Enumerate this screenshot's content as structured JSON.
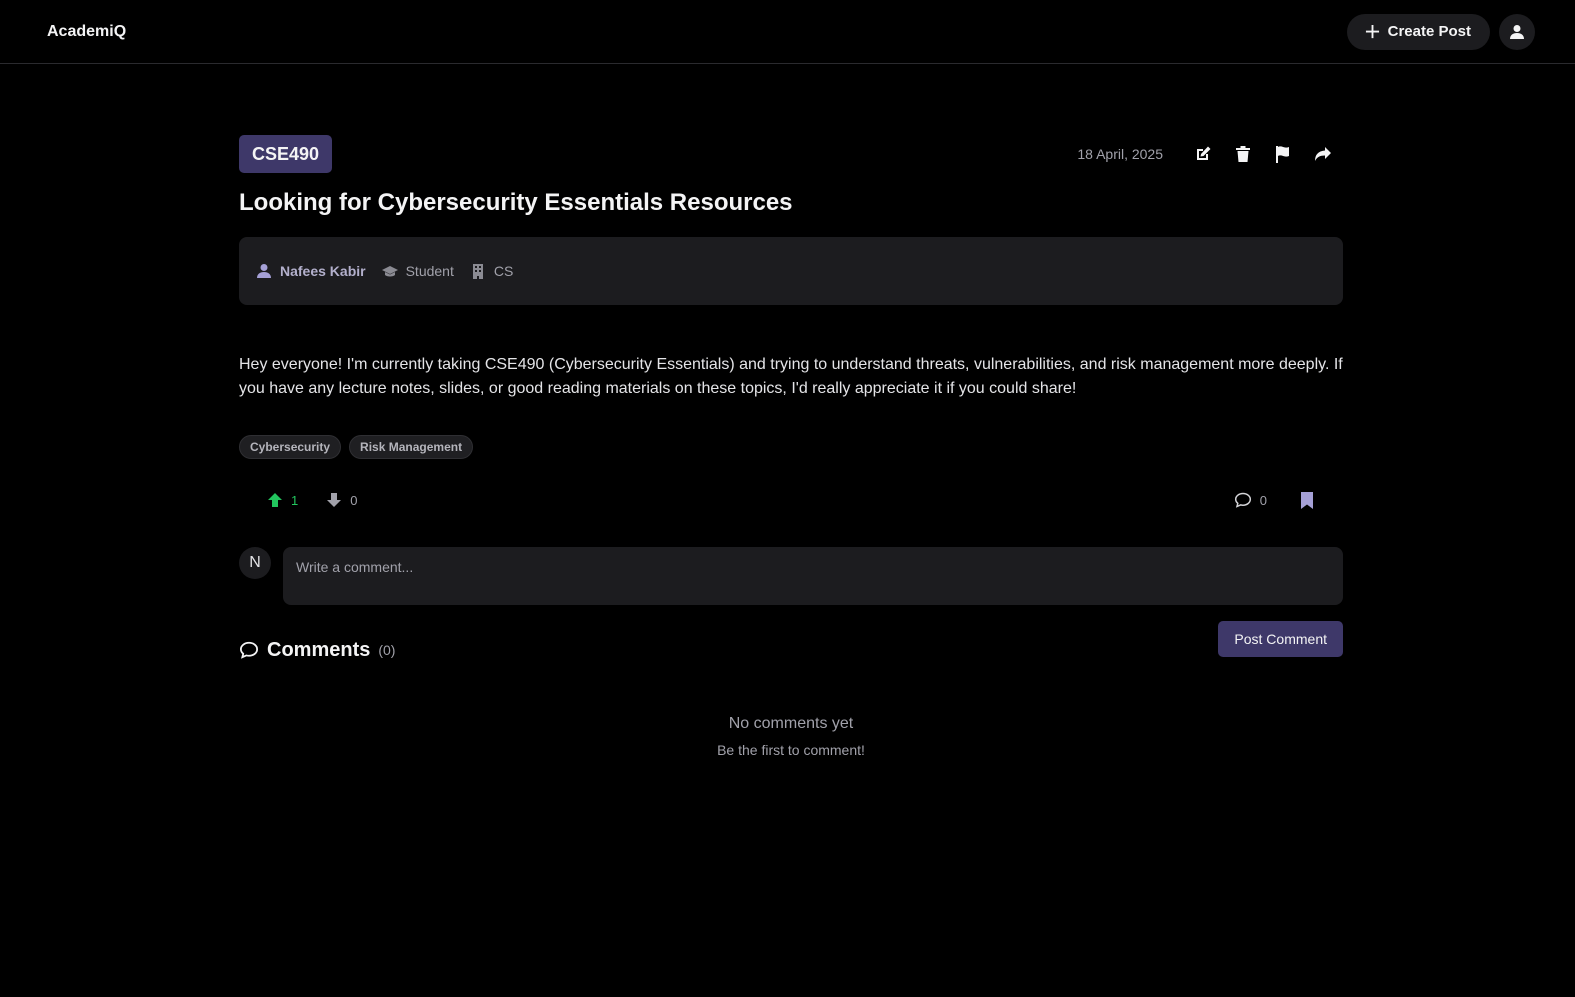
{
  "app": {
    "title": "AcademiQ"
  },
  "header": {
    "create_label": "Create Post"
  },
  "post": {
    "course": "CSE490",
    "date": "18 April, 2025",
    "title": "Looking for Cybersecurity Essentials Resources",
    "author": {
      "name": "Nafees Kabir",
      "role": "Student",
      "department": "CS"
    },
    "body": "Hey everyone! I'm currently taking CSE490 (Cybersecurity Essentials) and trying to understand threats, vulnerabilities, and risk management more deeply. If you have any lecture notes, slides, or good reading materials on these topics, I'd really appreciate it if you could share!",
    "tags": [
      "Cybersecurity",
      "Risk Management"
    ],
    "upvotes": "1",
    "downvotes": "0",
    "comment_count": "0"
  },
  "comment_form": {
    "avatar_initial": "N",
    "placeholder": "Write a comment...",
    "submit_label": "Post Comment"
  },
  "comments": {
    "title": "Comments",
    "count": "(0)",
    "empty_title": "No comments yet",
    "empty_subtitle": "Be the first to comment!"
  },
  "colors": {
    "accent": "#3e3869",
    "upvote": "#22c55e",
    "bookmark": "#a5a0d6",
    "surface": "#1c1c1f"
  }
}
